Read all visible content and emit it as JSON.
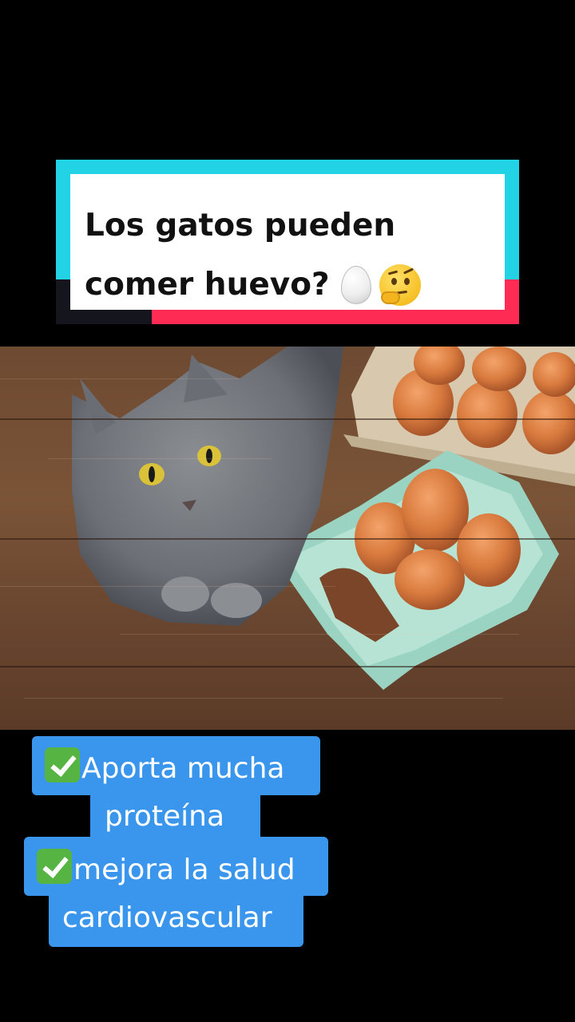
{
  "title": {
    "line1": "Los gatos pueden",
    "line2": "comer huevo?",
    "emojis": [
      "egg-icon",
      "thinking-face-icon"
    ]
  },
  "photo": {
    "subject": ""
  },
  "caption": {
    "line1": "Aporta mucha",
    "line2": "proteína",
    "line3": "mejora la salud",
    "line4": "cardiovascular",
    "bullet_icon": "check-mark-button-icon"
  },
  "colors": {
    "background": "#000000",
    "title_cyan": "#22d3e6",
    "title_red": "#fe2c55",
    "caption_bg": "#3a96ec",
    "check_green": "#56b443"
  }
}
